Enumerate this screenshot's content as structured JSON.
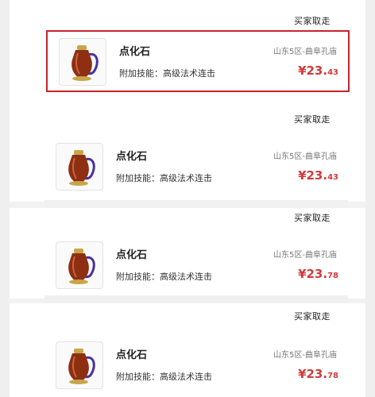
{
  "listings": [
    {
      "status": "买家取走",
      "name": "点化石",
      "skill": "附加技能：高级法术连击",
      "server": "山东5区-曲阜孔庙",
      "price_main": "¥23.",
      "price_cents": "43",
      "selected": true
    },
    {
      "status": "买家取走",
      "name": "点化石",
      "skill": "附加技能：高级法术连击",
      "server": "山东5区-曲阜孔庙",
      "price_main": "¥23.",
      "price_cents": "43",
      "selected": false
    },
    {
      "status": "买家取走",
      "name": "点化石",
      "skill": "附加技能：高级法术连击",
      "server": "山东5区-曲阜孔庙",
      "price_main": "¥23.",
      "price_cents": "78",
      "selected": false
    },
    {
      "status": "买家取走",
      "name": "点化石",
      "skill": "附加技能：高级法术连击",
      "server": "山东5区-曲阜孔庙",
      "price_main": "¥23.",
      "price_cents": "78",
      "selected": false
    }
  ],
  "colors": {
    "price": "#d03a3a",
    "highlight_border": "#c9232b",
    "vase_body": "#8e2f12",
    "handle": "#4a2fa0"
  },
  "icons": {
    "item_thumbnail": "vase-icon"
  }
}
